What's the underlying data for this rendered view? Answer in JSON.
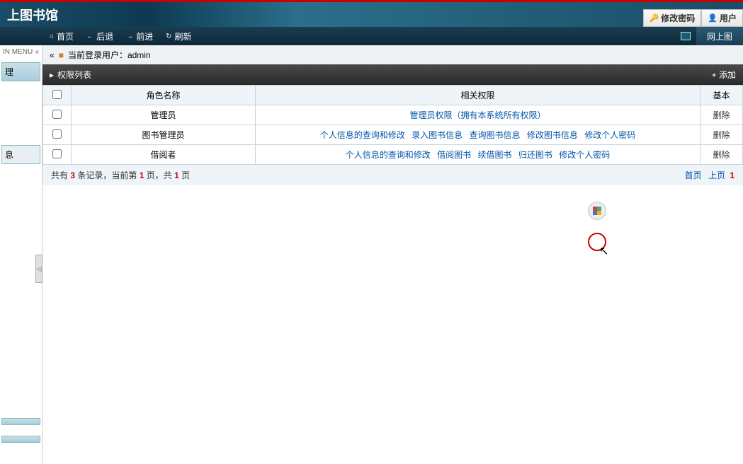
{
  "header": {
    "title": "上图书馆",
    "change_password": "修改密码",
    "user_btn": "用户"
  },
  "nav": {
    "home": "首页",
    "back": "后退",
    "forward": "前进",
    "refresh": "刷新",
    "right_tab": "网上图"
  },
  "sidebar": {
    "menu_label": "IN MENU",
    "item1": "理",
    "item2": "息"
  },
  "user_bar": {
    "text": "当前登录用户：admin"
  },
  "panel": {
    "title": "权限列表",
    "add": "+ 添加"
  },
  "table": {
    "headers": {
      "checkbox": "",
      "role_name": "角色名称",
      "permissions": "相关权限",
      "actions": "基本"
    },
    "rows": [
      {
        "role": "管理员",
        "perms": [
          {
            "text": "管理员权限（拥有本系统所有权限）"
          }
        ],
        "action": "删除"
      },
      {
        "role": "图书管理员",
        "perms": [
          {
            "text": "个人信息的查询和修改"
          },
          {
            "text": "录入图书信息"
          },
          {
            "text": "查询图书信息"
          },
          {
            "text": "修改图书信息"
          },
          {
            "text": "修改个人密码"
          }
        ],
        "action": "删除"
      },
      {
        "role": "借阅者",
        "perms": [
          {
            "text": "个人信息的查询和修改"
          },
          {
            "text": "借阅图书"
          },
          {
            "text": "续借图书"
          },
          {
            "text": "归还图书"
          },
          {
            "text": "修改个人密码"
          }
        ],
        "action": "删除"
      }
    ]
  },
  "pagination": {
    "total_records": "3",
    "current_page": "1",
    "total_pages": "1",
    "prefix": "共有",
    "mid1": "条记录，当前第",
    "mid2": "页，共",
    "suffix": "页",
    "first": "首页",
    "prev": "上页",
    "pagenum": "1"
  }
}
